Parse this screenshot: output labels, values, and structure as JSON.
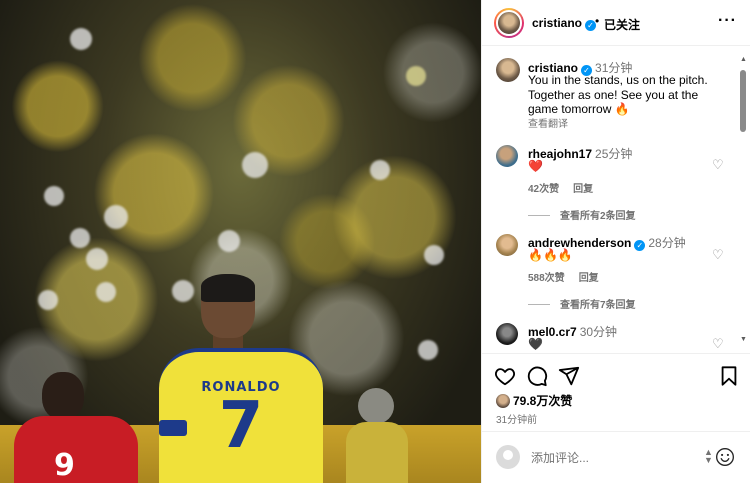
{
  "post": {
    "author": "cristiano",
    "follow_status": "已关注",
    "caption": {
      "username": "cristiano",
      "time": "31分钟",
      "text": "You in the stands, us on the pitch. Together as one! See you at the game tomorrow 🔥",
      "see_translation": "查看翻译"
    },
    "image": {
      "jersey_name": "RONALDO",
      "jersey_number": "7",
      "opponent_number": "9"
    }
  },
  "comments": [
    {
      "username": "rheajohn17",
      "verified": false,
      "time": "25分钟",
      "text": "❤️",
      "likes": "42次赞",
      "reply": "回复",
      "view_replies": "查看所有2条回复"
    },
    {
      "username": "andrewhenderson",
      "verified": true,
      "time": "28分钟",
      "text": "🔥🔥🔥",
      "likes": "588次赞",
      "reply": "回复",
      "view_replies": "查看所有7条回复"
    },
    {
      "username": "mel0.cr7",
      "verified": false,
      "time": "30分钟",
      "text": "🖤"
    }
  ],
  "stats": {
    "likes": "79.8万次赞",
    "posted": "31分钟前"
  },
  "add_comment": {
    "placeholder": "添加评论..."
  },
  "icons": {
    "more": "more-icon",
    "like": "heart-icon",
    "comment": "comment-icon",
    "share": "share-icon",
    "save": "bookmark-icon",
    "emoji": "emoji-icon",
    "verified": "verified-badge-icon"
  },
  "colors": {
    "verified_blue": "#0095f6",
    "jersey_yellow": "#f0e13a",
    "jersey_blue": "#1d3a8a",
    "opponent_red": "#c81d25"
  }
}
